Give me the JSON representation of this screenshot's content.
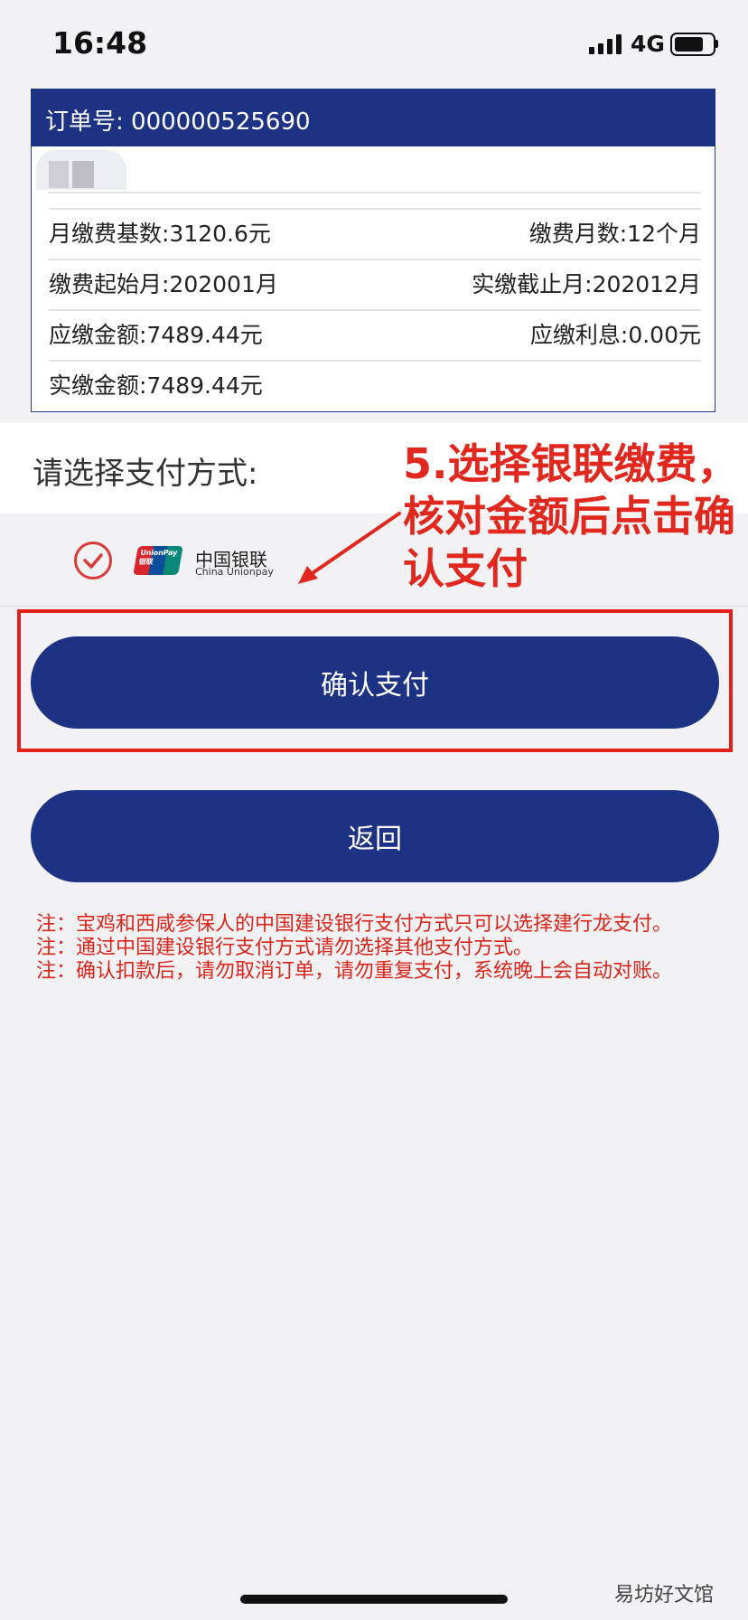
{
  "status_bar": {
    "time": "16:48",
    "network": "4G"
  },
  "order": {
    "order_number_label": "订单号: 000000525690",
    "monthly_base": "月缴费基数:3120.6元",
    "months": "缴费月数:12个月",
    "start_month": "缴费起始月:202001月",
    "end_month": "实缴截止月:202012月",
    "amount_due": "应缴金额:7489.44元",
    "interest_due": "应缴利息:0.00元",
    "actual_amount": "实缴金额:7489.44元"
  },
  "payment": {
    "title": "请选择支付方式:",
    "option_logo_text": "UnionPay 银联",
    "option_name_cn": "中国银联",
    "option_name_en": "China Unionpay"
  },
  "buttons": {
    "confirm_label": "确认支付",
    "back_label": "返回"
  },
  "annotation": {
    "lines": [
      "5.选择银联缴费，",
      "核对金额后点击确",
      "认支付"
    ]
  },
  "notes": [
    "注：宝鸡和西咸参保人的中国建设银行支付方式只可以选择建行龙支付。",
    "注：通过中国建设银行支付方式请勿选择其他支付方式。",
    "注：确认扣款后，请勿取消订单，请勿重复支付，系统晚上会自动对账。"
  ],
  "watermark": "易坊好文馆",
  "colors": {
    "brand_blue": "#1e3283",
    "annotation_red": "#e0281f",
    "note_red": "#d9261c"
  }
}
